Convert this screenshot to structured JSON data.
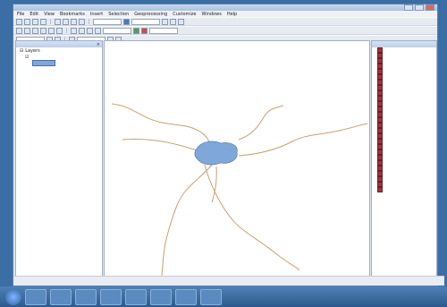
{
  "app": {
    "title": "",
    "menu": [
      "File",
      "Edit",
      "View",
      "Bookmarks",
      "Insert",
      "Selection",
      "Geoprocessing",
      "Customize",
      "Windows",
      "Help"
    ]
  },
  "toc": {
    "title": "",
    "rows": [
      "Layers",
      ""
    ]
  },
  "catalog": {
    "title": "",
    "items": [
      "",
      "",
      "",
      "",
      "",
      "",
      "",
      "",
      "",
      "",
      "",
      "",
      "",
      "",
      "",
      "",
      "",
      "",
      "",
      "",
      "",
      "",
      "",
      "",
      "",
      "",
      ""
    ]
  },
  "status": {
    "coords": ""
  },
  "colors": {
    "river": "#c9a073",
    "lake": "#7fa7d9",
    "accent": "#4a78c0",
    "swatch": "#a8323a"
  }
}
